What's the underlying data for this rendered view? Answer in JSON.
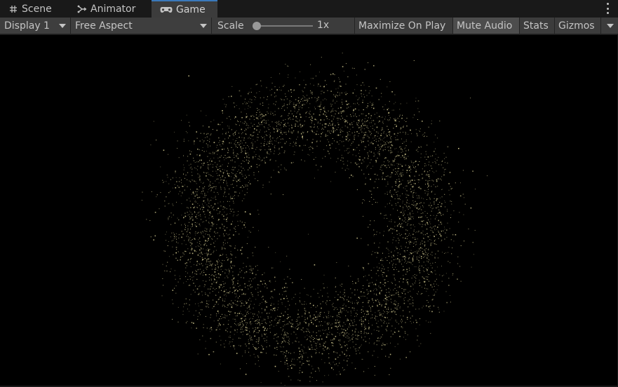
{
  "tabs": [
    {
      "label": "Scene",
      "icon": "grid-icon"
    },
    {
      "label": "Animator",
      "icon": "animator-icon"
    },
    {
      "label": "Game",
      "icon": "gamepad-icon",
      "active": true
    }
  ],
  "toolbar": {
    "display": "Display 1",
    "aspect": "Free Aspect",
    "scale_label": "Scale",
    "scale_value": "1x",
    "maximize_on_play": "Maximize On Play",
    "mute_audio": "Mute Audio",
    "stats": "Stats",
    "gizmos": "Gizmos"
  },
  "game_view": {
    "background": "#000000",
    "particle_color": "#c8c089",
    "content": "ring of particles"
  },
  "colors": {
    "active_tab_accent": "#3a79bb",
    "toolbar_bg": "#3c3c3c",
    "tabbar_bg": "#191919",
    "toggled_button_bg": "#4d4d4d"
  }
}
